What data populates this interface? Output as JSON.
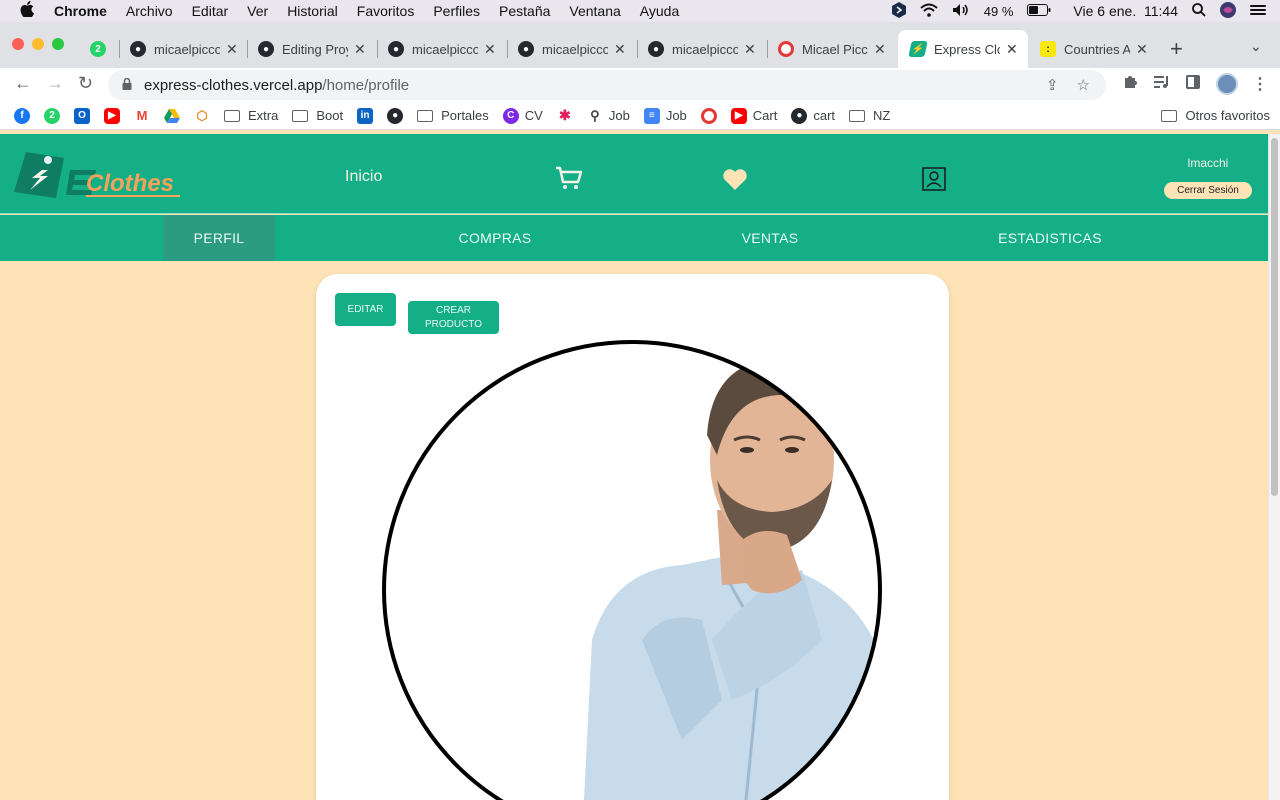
{
  "menubar": {
    "app_name": "Chrome",
    "items": [
      "Archivo",
      "Editar",
      "Ver",
      "Historial",
      "Favoritos",
      "Perfiles",
      "Pestaña",
      "Ventana",
      "Ayuda"
    ],
    "battery": "49 %",
    "datetime": "Vie 6 ene.  11:44"
  },
  "tabs": [
    {
      "title": "",
      "badge": "2",
      "icon": "whatsapp-icon"
    },
    {
      "title": "micaelpicco",
      "icon": "github-icon"
    },
    {
      "title": "Editing Proy",
      "icon": "github-icon"
    },
    {
      "title": "micaelpicco",
      "icon": "github-icon"
    },
    {
      "title": "micaelpicco",
      "icon": "github-icon"
    },
    {
      "title": "micaelpicco",
      "icon": "github-icon"
    },
    {
      "title": "Micael Picc",
      "icon": "target-icon"
    },
    {
      "title": "Express Clo",
      "icon": "express-clothes-icon",
      "active": true
    },
    {
      "title": "Countries A",
      "icon": "henry-icon"
    }
  ],
  "address": {
    "domain": "express-clothes.vercel.app",
    "path": "/home/profile"
  },
  "bookmarks": [
    {
      "label": "",
      "icon": "facebook-icon"
    },
    {
      "label": "",
      "icon": "whatsapp-icon",
      "badge": "2"
    },
    {
      "label": "",
      "icon": "outlook-icon",
      "badge": "O"
    },
    {
      "label": "",
      "icon": "youtube-icon"
    },
    {
      "label": "",
      "icon": "gmail-icon"
    },
    {
      "label": "",
      "icon": "drive-icon"
    },
    {
      "label": "",
      "icon": "box-icon"
    },
    {
      "label": "Extra",
      "icon": "folder-icon"
    },
    {
      "label": "Boot",
      "icon": "folder-icon"
    },
    {
      "label": "",
      "icon": "linkedin-icon",
      "badge": "in"
    },
    {
      "label": "",
      "icon": "github-icon"
    },
    {
      "label": "Portales",
      "icon": "folder-icon"
    },
    {
      "label": "CV",
      "icon": "canva-icon",
      "badge": "C"
    },
    {
      "label": "",
      "icon": "slack-icon"
    },
    {
      "label": "Job",
      "icon": "search-icon"
    },
    {
      "label": "Job",
      "icon": "docs-icon"
    },
    {
      "label": "",
      "icon": "target-icon"
    },
    {
      "label": "Cart",
      "icon": "youtube-icon"
    },
    {
      "label": "cart",
      "icon": "github-icon"
    },
    {
      "label": "NZ",
      "icon": "folder-icon"
    }
  ],
  "other_bookmarks": "Otros favoritos",
  "site": {
    "logo_text": "Clothes",
    "nav_home": "Inicio",
    "username": "lmacchi",
    "logout": "Cerrar Sesión",
    "colors": {
      "primary": "#14ae87",
      "background": "#fde3b6",
      "accent": "#fde3b6"
    }
  },
  "profile_nav": [
    {
      "label": "PERFIL",
      "active": true
    },
    {
      "label": "COMPRAS"
    },
    {
      "label": "VENTAS"
    },
    {
      "label": "ESTADISTICAS"
    }
  ],
  "profile": {
    "edit_button": "EDITAR",
    "create_button": "CREAR PRODUCTO"
  }
}
